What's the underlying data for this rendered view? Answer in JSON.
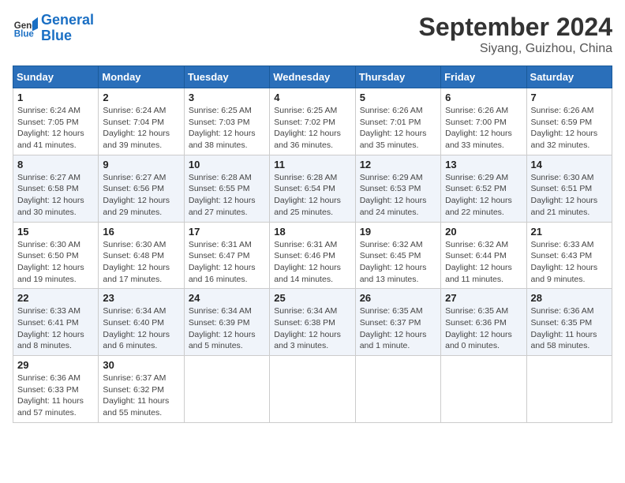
{
  "header": {
    "logo_line1": "General",
    "logo_line2": "Blue",
    "month": "September 2024",
    "location": "Siyang, Guizhou, China"
  },
  "weekdays": [
    "Sunday",
    "Monday",
    "Tuesday",
    "Wednesday",
    "Thursday",
    "Friday",
    "Saturday"
  ],
  "weeks": [
    [
      {
        "day": "1",
        "info": "Sunrise: 6:24 AM\nSunset: 7:05 PM\nDaylight: 12 hours\nand 41 minutes."
      },
      {
        "day": "2",
        "info": "Sunrise: 6:24 AM\nSunset: 7:04 PM\nDaylight: 12 hours\nand 39 minutes."
      },
      {
        "day": "3",
        "info": "Sunrise: 6:25 AM\nSunset: 7:03 PM\nDaylight: 12 hours\nand 38 minutes."
      },
      {
        "day": "4",
        "info": "Sunrise: 6:25 AM\nSunset: 7:02 PM\nDaylight: 12 hours\nand 36 minutes."
      },
      {
        "day": "5",
        "info": "Sunrise: 6:26 AM\nSunset: 7:01 PM\nDaylight: 12 hours\nand 35 minutes."
      },
      {
        "day": "6",
        "info": "Sunrise: 6:26 AM\nSunset: 7:00 PM\nDaylight: 12 hours\nand 33 minutes."
      },
      {
        "day": "7",
        "info": "Sunrise: 6:26 AM\nSunset: 6:59 PM\nDaylight: 12 hours\nand 32 minutes."
      }
    ],
    [
      {
        "day": "8",
        "info": "Sunrise: 6:27 AM\nSunset: 6:58 PM\nDaylight: 12 hours\nand 30 minutes."
      },
      {
        "day": "9",
        "info": "Sunrise: 6:27 AM\nSunset: 6:56 PM\nDaylight: 12 hours\nand 29 minutes."
      },
      {
        "day": "10",
        "info": "Sunrise: 6:28 AM\nSunset: 6:55 PM\nDaylight: 12 hours\nand 27 minutes."
      },
      {
        "day": "11",
        "info": "Sunrise: 6:28 AM\nSunset: 6:54 PM\nDaylight: 12 hours\nand 25 minutes."
      },
      {
        "day": "12",
        "info": "Sunrise: 6:29 AM\nSunset: 6:53 PM\nDaylight: 12 hours\nand 24 minutes."
      },
      {
        "day": "13",
        "info": "Sunrise: 6:29 AM\nSunset: 6:52 PM\nDaylight: 12 hours\nand 22 minutes."
      },
      {
        "day": "14",
        "info": "Sunrise: 6:30 AM\nSunset: 6:51 PM\nDaylight: 12 hours\nand 21 minutes."
      }
    ],
    [
      {
        "day": "15",
        "info": "Sunrise: 6:30 AM\nSunset: 6:50 PM\nDaylight: 12 hours\nand 19 minutes."
      },
      {
        "day": "16",
        "info": "Sunrise: 6:30 AM\nSunset: 6:48 PM\nDaylight: 12 hours\nand 17 minutes."
      },
      {
        "day": "17",
        "info": "Sunrise: 6:31 AM\nSunset: 6:47 PM\nDaylight: 12 hours\nand 16 minutes."
      },
      {
        "day": "18",
        "info": "Sunrise: 6:31 AM\nSunset: 6:46 PM\nDaylight: 12 hours\nand 14 minutes."
      },
      {
        "day": "19",
        "info": "Sunrise: 6:32 AM\nSunset: 6:45 PM\nDaylight: 12 hours\nand 13 minutes."
      },
      {
        "day": "20",
        "info": "Sunrise: 6:32 AM\nSunset: 6:44 PM\nDaylight: 12 hours\nand 11 minutes."
      },
      {
        "day": "21",
        "info": "Sunrise: 6:33 AM\nSunset: 6:43 PM\nDaylight: 12 hours\nand 9 minutes."
      }
    ],
    [
      {
        "day": "22",
        "info": "Sunrise: 6:33 AM\nSunset: 6:41 PM\nDaylight: 12 hours\nand 8 minutes."
      },
      {
        "day": "23",
        "info": "Sunrise: 6:34 AM\nSunset: 6:40 PM\nDaylight: 12 hours\nand 6 minutes."
      },
      {
        "day": "24",
        "info": "Sunrise: 6:34 AM\nSunset: 6:39 PM\nDaylight: 12 hours\nand 5 minutes."
      },
      {
        "day": "25",
        "info": "Sunrise: 6:34 AM\nSunset: 6:38 PM\nDaylight: 12 hours\nand 3 minutes."
      },
      {
        "day": "26",
        "info": "Sunrise: 6:35 AM\nSunset: 6:37 PM\nDaylight: 12 hours\nand 1 minute."
      },
      {
        "day": "27",
        "info": "Sunrise: 6:35 AM\nSunset: 6:36 PM\nDaylight: 12 hours\nand 0 minutes."
      },
      {
        "day": "28",
        "info": "Sunrise: 6:36 AM\nSunset: 6:35 PM\nDaylight: 11 hours\nand 58 minutes."
      }
    ],
    [
      {
        "day": "29",
        "info": "Sunrise: 6:36 AM\nSunset: 6:33 PM\nDaylight: 11 hours\nand 57 minutes."
      },
      {
        "day": "30",
        "info": "Sunrise: 6:37 AM\nSunset: 6:32 PM\nDaylight: 11 hours\nand 55 minutes."
      },
      {
        "day": "",
        "info": ""
      },
      {
        "day": "",
        "info": ""
      },
      {
        "day": "",
        "info": ""
      },
      {
        "day": "",
        "info": ""
      },
      {
        "day": "",
        "info": ""
      }
    ]
  ]
}
